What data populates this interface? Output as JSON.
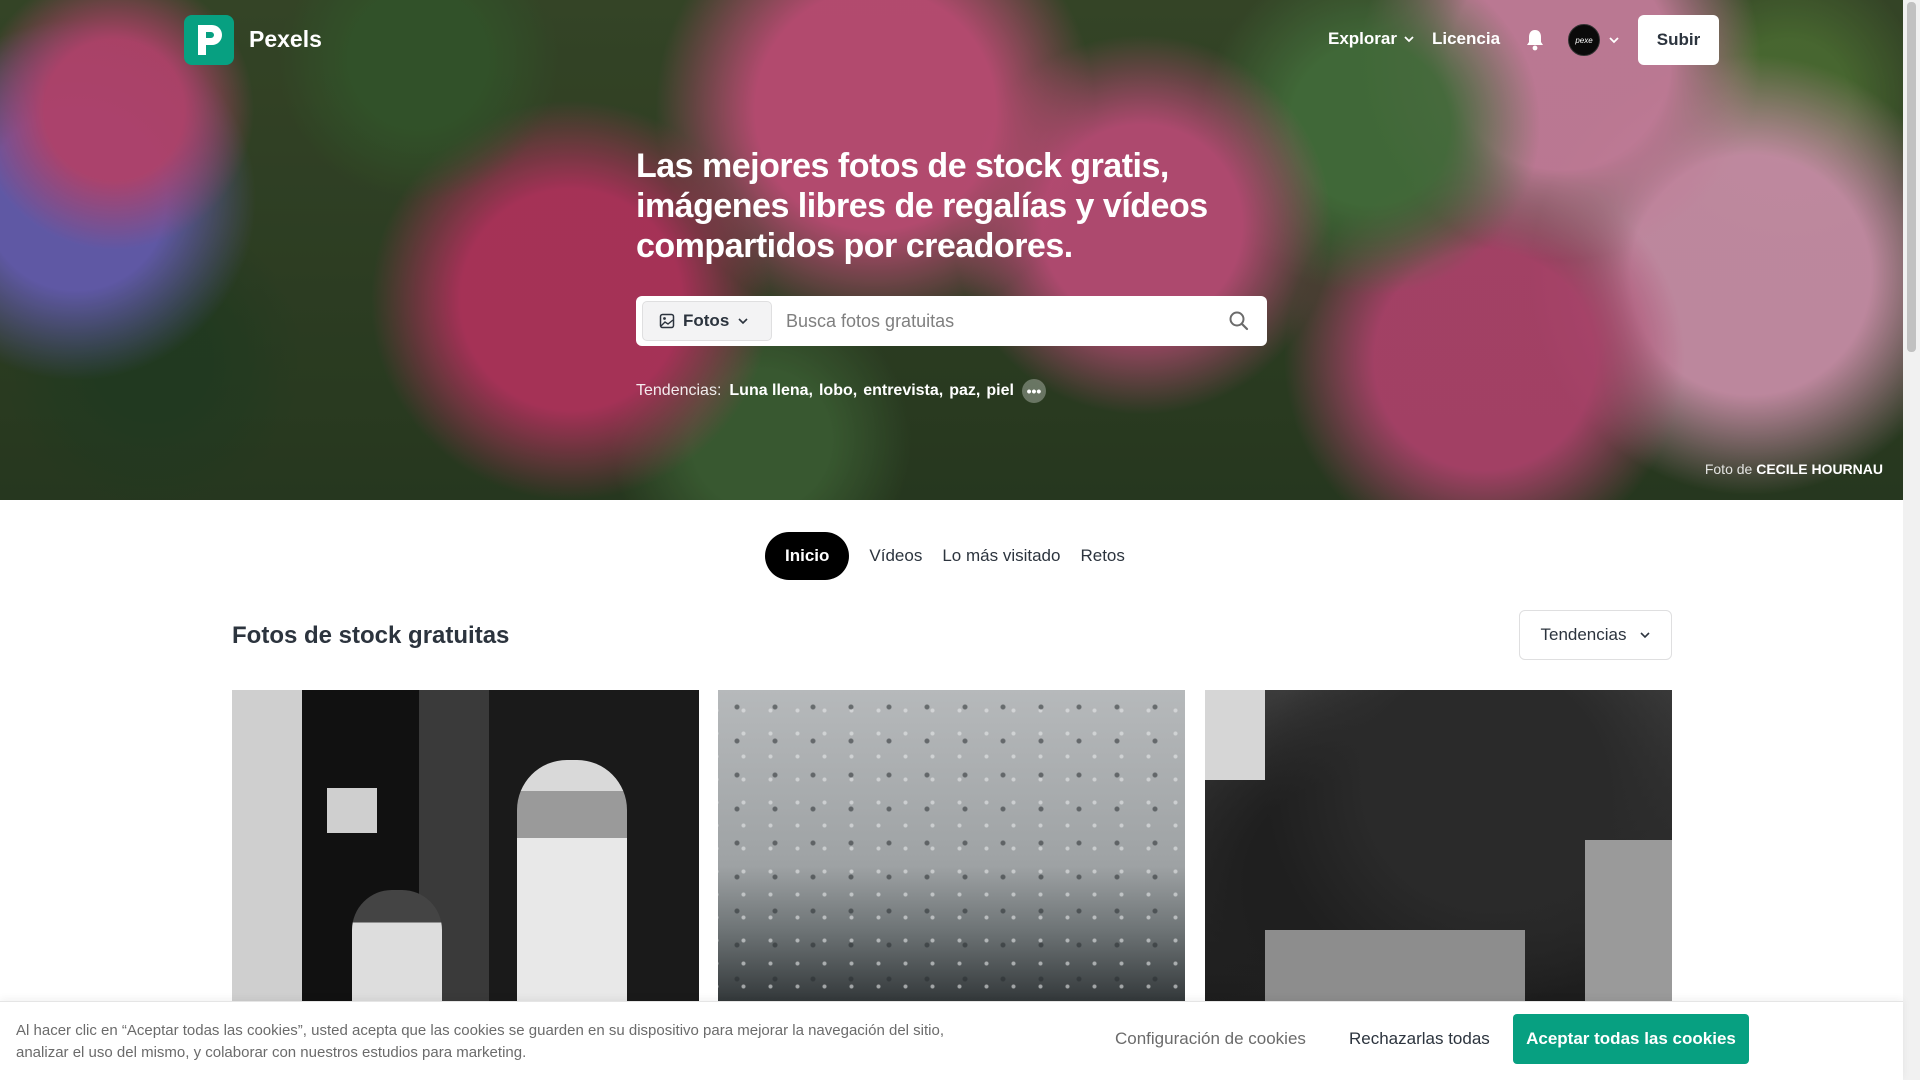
{
  "nav": {
    "logo_text": "Pexels",
    "explore": "Explorar",
    "license": "Licencia",
    "avatar_text": "pexe",
    "upload": "Subir"
  },
  "hero": {
    "title": "Las mejores fotos de stock gratis, imágenes libres de regalías y vídeos compartidos por creadores.",
    "search_type": "Fotos",
    "search_placeholder": "Busca fotos gratuitas",
    "trends_label": "Tendencias:",
    "trends": [
      "Luna llena",
      "lobo",
      "entrevista",
      "paz",
      "piel"
    ],
    "more": "•••",
    "credit_prefix": "Foto de",
    "credit_author": "CECILE HOURNAU"
  },
  "tabs": [
    "Inicio",
    "Vídeos",
    "Lo más visitado",
    "Retos"
  ],
  "section": {
    "title": "Fotos de stock gratuitas",
    "sort": "Tendencias"
  },
  "cookie": {
    "text": "Al hacer clic en “Aceptar todas las cookies”, usted acepta que las cookies se guarden en su dispositivo para mejorar la navegación del sitio, analizar el uso del mismo, y colaborar con nuestros estudios para marketing.",
    "settings": "Configuración de cookies",
    "reject": "Rechazarlas todas",
    "accept": "Aceptar todas las cookies"
  },
  "colors": {
    "brand": "#07a081",
    "text": "#2c343e"
  }
}
